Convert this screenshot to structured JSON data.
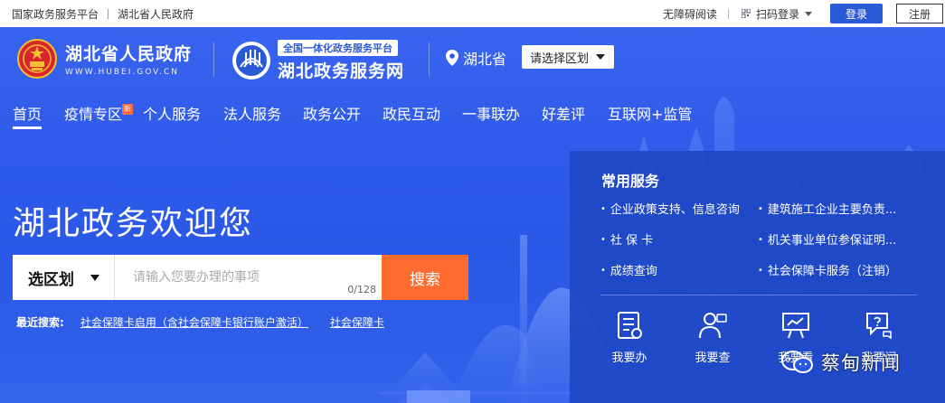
{
  "topbar": {
    "left_links": [
      "国家政务服务平台",
      "湖北省人民政府"
    ],
    "accessibility": "无障碍阅读",
    "qr_login": "扫码登录",
    "login": "登录",
    "register": "注册"
  },
  "brand": {
    "title": "湖北省人民政府",
    "subtitle": "WWW.HUBEI.GOV.CN",
    "platform_tag": "全国一体化政务服务平台",
    "platform_name": "湖北政务服务网"
  },
  "region": {
    "current": "湖北省",
    "select_label": "请选择区划"
  },
  "nav": {
    "items": [
      "首页",
      "疫情专区",
      "个人服务",
      "法人服务",
      "政务公开",
      "政民互动",
      "一事联办",
      "好差评",
      "互联网+监管"
    ],
    "badge": "新"
  },
  "hero": {
    "welcome": "湖北政务欢迎您"
  },
  "search": {
    "scope": "选区划",
    "placeholder": "请输入您要办理的事项",
    "count": "0/128",
    "button": "搜索",
    "recent_label": "最近搜索:",
    "recent_items": [
      "社会保障卡启用（含社会保障卡银行账户激活）",
      "社会保障卡"
    ]
  },
  "services": {
    "title": "常用服务",
    "items": [
      "企业政策支持、信息咨询",
      "建筑施工企业主要负责...",
      "社 保 卡",
      "机关事业单位参保证明...",
      "成绩查询",
      "社会保障卡服务（注销）"
    ],
    "quick": [
      "我要办",
      "我要查",
      "我要看",
      "我要问"
    ]
  },
  "watermark": {
    "text": "蔡甸新闻"
  },
  "colors": {
    "primary": "#2b5ad9",
    "hero_bg": "#2f5aea",
    "search_button": "#ff6c2e",
    "panel_bg": "#1e48c4"
  }
}
